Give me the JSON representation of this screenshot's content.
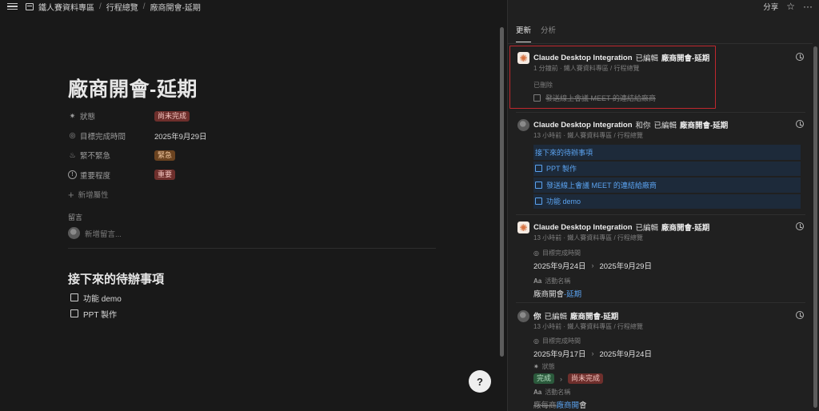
{
  "breadcrumb": {
    "workspace": "鐵人賽資料專區",
    "parent": "行程總覽",
    "current": "廠商開會-延期"
  },
  "page": {
    "title": "廠商開會-延期",
    "properties": [
      {
        "icon": "status-icon",
        "label": "狀態",
        "value": "尚未完成",
        "color": "#6e2f2c"
      },
      {
        "icon": "target-icon",
        "label": "目標完成時間",
        "value": "2025年9月29日"
      },
      {
        "icon": "fire-icon",
        "label": "緊不緊急",
        "value": "緊急",
        "color": "#6b4320"
      },
      {
        "icon": "info-icon",
        "label": "重要程度",
        "value": "重要",
        "color": "#6e2f2c"
      }
    ],
    "add_property": "新增屬性",
    "comments_label": "留言",
    "comment_placeholder": "新增留言...",
    "section_heading": "接下來的待辦事項",
    "todos": [
      "功能 demo",
      "PPT 製作"
    ]
  },
  "help_button": "?",
  "panel": {
    "share_label": "分享",
    "tabs": [
      "更新",
      "分析"
    ],
    "entries": [
      {
        "actor": "Claude Desktop Integration",
        "verb": "已編輯",
        "target": "廠商開會-延期",
        "meta": "1 分鐘前 · 鐵人賽資料專區 / 行程總覽",
        "deleted_label": "已刪除",
        "deleted_item": "發送線上會議 MEET 的連結給廠商"
      },
      {
        "actor": "Claude Desktop Integration",
        "conj": "和你",
        "verb": "已編輯",
        "target": "廠商開會-延期",
        "meta": "13 小時前 · 鐵人賽資料專區 / 行程總覽",
        "blocks": [
          "接下來的待辦事項",
          "PPT 製作",
          "發送線上會議 MEET 的連結給廠商",
          "功能 demo"
        ]
      },
      {
        "actor": "Claude Desktop Integration",
        "verb": "已編輯",
        "target": "廠商開會-延期",
        "meta": "13 小時前 · 鐵人賽資料專區 / 行程總覽",
        "date_label": "目標完成時間",
        "date_from": "2025年9月24日",
        "date_to": "2025年9月29日",
        "name_label": "活動名稱",
        "name_base": "廠商開會",
        "name_added": "-延期"
      },
      {
        "actor": "你",
        "verb": "已編輯",
        "target": "廠商開會-延期",
        "meta": "13 小時前 · 鐵人賽資料專區 / 行程總覽",
        "date_label": "目標完成時間",
        "date_from": "2025年9月17日",
        "date_to": "2025年9月24日",
        "status_label": "狀態",
        "status_from": "完成",
        "status_to": "尚未完成",
        "name_label": "活動名稱",
        "name_removed": "廠每商",
        "name_added": "廠商開",
        "name_tail": "會"
      }
    ]
  }
}
